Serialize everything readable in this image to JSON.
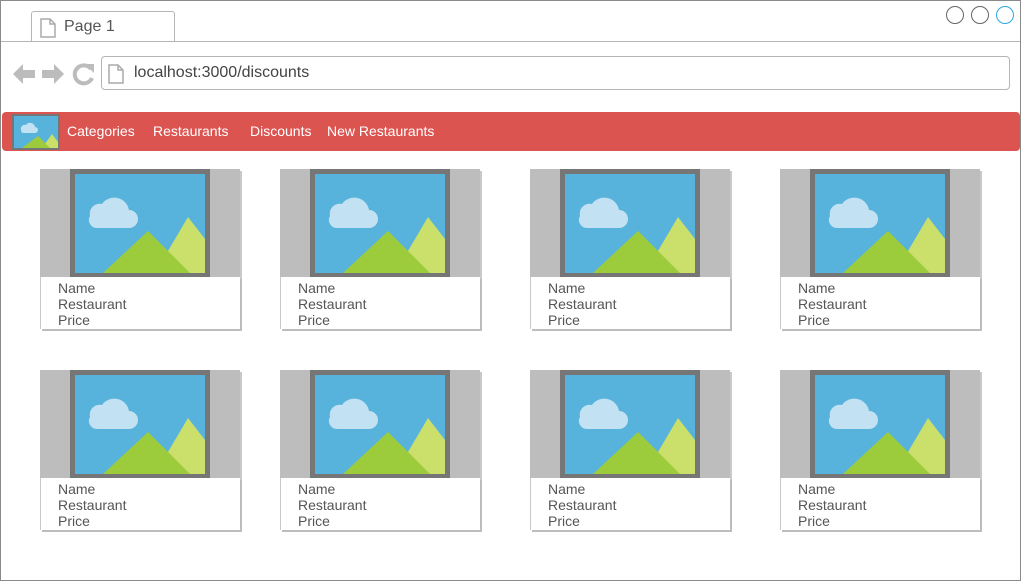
{
  "browser": {
    "tab_title": "Page 1",
    "url": "localhost:3000/discounts"
  },
  "nav": {
    "links": [
      "Categories",
      "Restaurants",
      "Discounts",
      "New Restaurants"
    ]
  },
  "cards": [
    {
      "name": "Name",
      "restaurant": "Restaurant",
      "price": "Price"
    },
    {
      "name": "Name",
      "restaurant": "Restaurant",
      "price": "Price"
    },
    {
      "name": "Name",
      "restaurant": "Restaurant",
      "price": "Price"
    },
    {
      "name": "Name",
      "restaurant": "Restaurant",
      "price": "Price"
    },
    {
      "name": "Name",
      "restaurant": "Restaurant",
      "price": "Price"
    },
    {
      "name": "Name",
      "restaurant": "Restaurant",
      "price": "Price"
    },
    {
      "name": "Name",
      "restaurant": "Restaurant",
      "price": "Price"
    },
    {
      "name": "Name",
      "restaurant": "Restaurant",
      "price": "Price"
    }
  ],
  "colors": {
    "nav_bg": "#dc5450",
    "image_sky": "#58b3dc",
    "image_frame": "#767676",
    "window_control_active": "#2aa9e0"
  },
  "icons": [
    "document-icon",
    "back-arrow-icon",
    "forward-arrow-icon",
    "reload-icon",
    "image-placeholder-icon"
  ]
}
